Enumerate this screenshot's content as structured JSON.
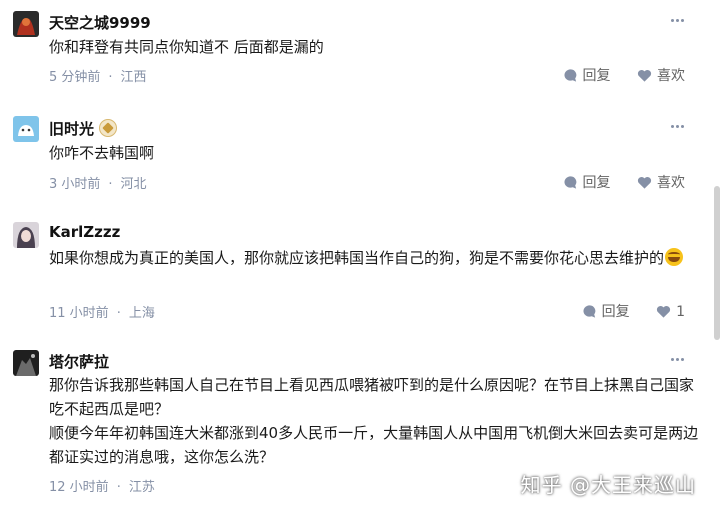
{
  "comments": [
    {
      "username": "天空之城9999",
      "text": "你和拜登有共同点你知道不 后面都是漏的",
      "time": "5 分钟前",
      "location": "江西",
      "reply_label": "回复",
      "like_label": "喜欢"
    },
    {
      "username": "旧时光",
      "text": "你咋不去韩国啊",
      "time": "3 小时前",
      "location": "河北",
      "reply_label": "回复",
      "like_label": "喜欢"
    },
    {
      "username": "KarlZzzz",
      "text": "如果你想成为真正的美国人，那你就应该把韩国当作自己的狗，狗是不需要你花心思去维护的",
      "time": "11 小时前",
      "location": "上海",
      "reply_label": "回复",
      "like_count": "1"
    },
    {
      "username": "塔尔萨拉",
      "text": "那你告诉我那些韩国人自己在节目上看见西瓜喂猪被吓到的是什么原因呢？在节目上抹黑自己国家吃不起西瓜是吧？\n顺便今年年初韩国连大米都涨到40多人民币一斤，大量韩国人从中国用飞机倒大米回去卖可是两边都证实过的消息哦，这你怎么洗？",
      "time": "12 小时前",
      "location": "江苏"
    }
  ],
  "separator": "·",
  "watermark": "知乎 @大王来巡山",
  "colors": {
    "meta": "#8590a6",
    "text": "#1a1a1a",
    "badge": "#c99a3a"
  }
}
